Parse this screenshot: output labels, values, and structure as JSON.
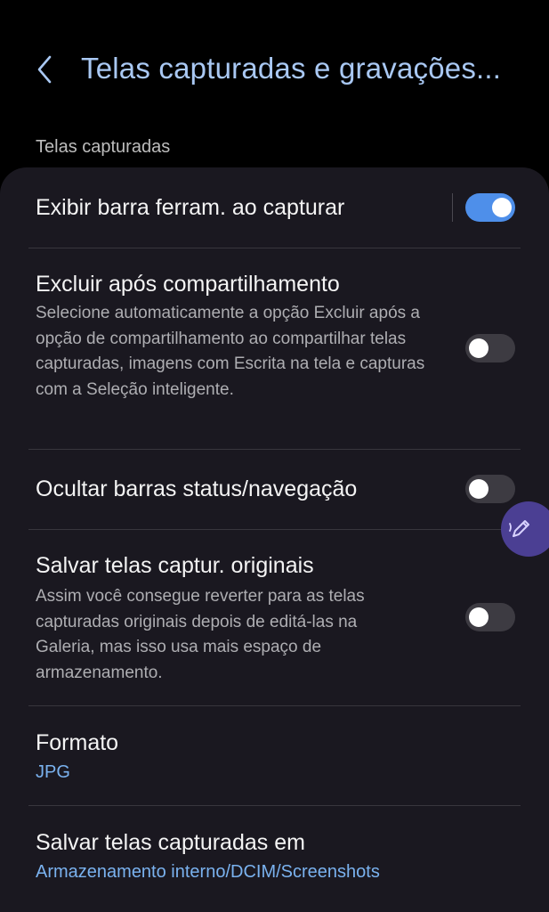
{
  "header": {
    "title": "Telas capturadas e gravações..."
  },
  "section": {
    "label": "Telas capturadas"
  },
  "settings": {
    "toolbar": {
      "title": "Exibir barra ferram. ao capturar",
      "enabled": true
    },
    "delete_after_share": {
      "title": "Excluir após compartilhamento",
      "description": "Selecione automaticamente a opção Excluir após a opção de compartilhamento ao compartilhar telas capturadas, imagens com Escrita na tela e capturas com a Seleção inteligente.",
      "enabled": false
    },
    "hide_bars": {
      "title": "Ocultar barras status/navegação",
      "enabled": false
    },
    "save_originals": {
      "title": "Salvar telas captur. originais",
      "description": "Assim você consegue reverter para as telas capturadas originais depois de editá-las na Galeria, mas isso usa mais espaço de armazenamento.",
      "enabled": false
    },
    "format": {
      "title": "Formato",
      "value": "JPG"
    },
    "save_location": {
      "title": "Salvar telas capturadas em",
      "value": "Armazenamento interno/DCIM/Screenshots"
    }
  },
  "colors": {
    "accent": "#4e8fea",
    "title": "#a9c8f3",
    "value_text": "#7ab2ef",
    "card_bg": "#1a1820",
    "fab_bg": "#4b3f93"
  },
  "icons": {
    "back": "chevron-left-icon",
    "fab": "pen-icon"
  }
}
